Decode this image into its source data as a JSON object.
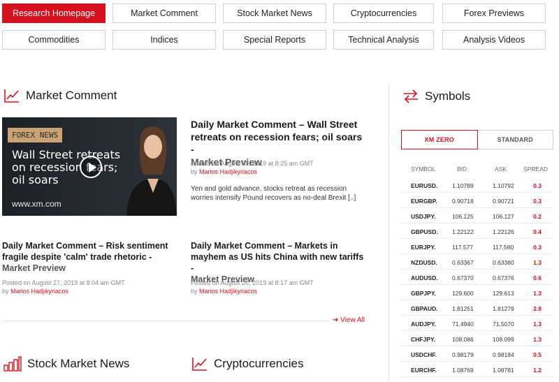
{
  "nav": [
    {
      "label": "Research Homepage",
      "active": true
    },
    {
      "label": "Market Comment"
    },
    {
      "label": "Stock Market News"
    },
    {
      "label": "Cryptocurrencies"
    },
    {
      "label": "Forex Previews"
    },
    {
      "label": "Commodities"
    },
    {
      "label": "Indices"
    },
    {
      "label": "Special Reports"
    },
    {
      "label": "Technical Analysis"
    },
    {
      "label": "Analysis Videos"
    }
  ],
  "market_comment": {
    "title": "Market Comment",
    "video": {
      "tag": "FOREX NEWS",
      "headline_line1": "Wall Street retreats",
      "headline_line2": "on recession fears;",
      "headline_line3": "oil soars",
      "url": "www.xm.com"
    },
    "featured": {
      "title": "Daily Market Comment – Wall Street retreats on recession fears; oil soars -",
      "subtitle": "Market Preview",
      "posted": "Posted on August 28, 2019 at 8:25 am GMT",
      "by": "by",
      "author": "Marios Hadjikyriacos",
      "excerpt": "Yen and gold advance, stocks retreat as recession worries intensify Pound recovers as no-deal Brexit [..]"
    },
    "articles": [
      {
        "title": "Daily Market Comment – Risk sentiment fragile despite 'calm' trade rhetoric -",
        "subtitle": "Market Preview",
        "posted": "Posted on August 27, 2019 at 8:04 am GMT",
        "by": "by",
        "author": "Marios Hadjikyriacos"
      },
      {
        "title": "Daily Market Comment – Markets in mayhem as US hits China with new tariffs -",
        "subtitle": "Market Preview",
        "posted": "Posted on August 26, 2019 at 8:17 am GMT",
        "by": "by",
        "author": "Marios Hadjikyriacos"
      }
    ],
    "view_all": "View All"
  },
  "stock_news": {
    "title": "Stock Market News"
  },
  "crypto": {
    "title": "Cryptocurrencies"
  },
  "symbols": {
    "title": "Symbols",
    "tabs": [
      "XM ZERO",
      "STANDARD"
    ],
    "headers": {
      "symbol": "SYMBOL",
      "bid": "BID",
      "ask": "ASK",
      "spread": "SPREAD"
    },
    "rows": [
      {
        "symbol": "EURUSD.",
        "bid": "1.10789",
        "ask": "1.10792",
        "spread": "0.3"
      },
      {
        "symbol": "EURGBP.",
        "bid": "0.90718",
        "ask": "0.90721",
        "spread": "0.3"
      },
      {
        "symbol": "USDJPY.",
        "bid": "106.125",
        "ask": "106.127",
        "spread": "0.2"
      },
      {
        "symbol": "GBPUSD.",
        "bid": "1.22122",
        "ask": "1.22126",
        "spread": "0.4"
      },
      {
        "symbol": "EURJPY.",
        "bid": "117.577",
        "ask": "117.580",
        "spread": "0.3"
      },
      {
        "symbol": "NZDUSD.",
        "bid": "0.63367",
        "ask": "0.63380",
        "spread": "1.3"
      },
      {
        "symbol": "AUDUSD.",
        "bid": "0.67370",
        "ask": "0.67376",
        "spread": "0.6"
      },
      {
        "symbol": "GBPJPY.",
        "bid": "129.600",
        "ask": "129.613",
        "spread": "1.3"
      },
      {
        "symbol": "GBPAUD.",
        "bid": "1.81251",
        "ask": "1.81279",
        "spread": "2.8"
      },
      {
        "symbol": "AUDJPY.",
        "bid": "71.4940",
        "ask": "71.5070",
        "spread": "1.3"
      },
      {
        "symbol": "CHFJPY.",
        "bid": "108.086",
        "ask": "108.099",
        "spread": "1.3"
      },
      {
        "symbol": "USDCHF.",
        "bid": "0.98179",
        "ask": "0.98184",
        "spread": "0.5"
      },
      {
        "symbol": "EURCHF.",
        "bid": "1.08769",
        "ask": "1.08781",
        "spread": "1.2"
      }
    ]
  },
  "colors": {
    "accent": "#d7101e",
    "border": "#cfcfcf"
  }
}
